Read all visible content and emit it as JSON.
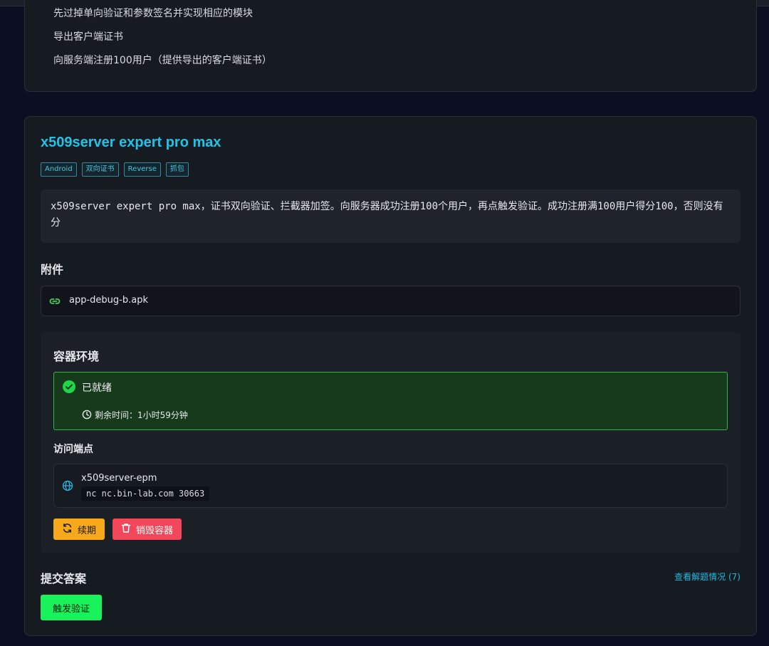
{
  "previous_card": {
    "items": [
      "先过掉单向验证和参数签名并实现相应的模块",
      "导出客户端证书",
      "向服务端注册100用户（提供导出的客户端证书）"
    ]
  },
  "challenge": {
    "title": "x509server expert pro max",
    "tags": [
      "Android",
      "双向证书",
      "Reverse",
      "抓包"
    ],
    "description": "x509server expert pro max，证书双向验证、拦截器加签。向服务器成功注册100个用户，再点触发验证。成功注册满100用户得分100，否则没有分"
  },
  "attachments": {
    "heading": "附件",
    "files": [
      "app-debug-b.apk"
    ]
  },
  "container": {
    "heading": "容器环境",
    "status_label": "已就绪",
    "remaining_time": "剩余时间：1小时59分钟",
    "endpoints_heading": "访问端点",
    "endpoint_name": "x509server-epm",
    "endpoint_command": "nc nc.bin-lab.com 30663",
    "renew_label": "续期",
    "destroy_label": "销毁容器"
  },
  "submit": {
    "heading": "提交答案",
    "view_solves_label": "查看解题情况 (7)",
    "trigger_label": "触发验证"
  },
  "colors": {
    "accent": "#22c3e6",
    "ready": "#21d64a",
    "renew": "#f7a81b",
    "destroy": "#f2475a",
    "trigger": "#19f25a"
  }
}
